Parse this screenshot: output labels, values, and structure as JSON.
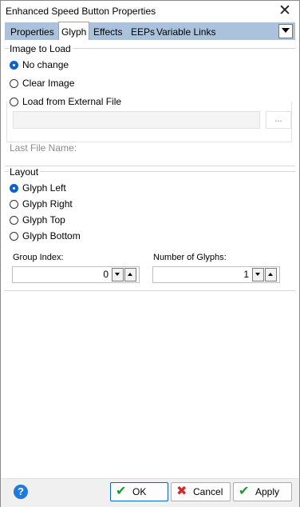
{
  "window": {
    "title": "Enhanced Speed Button Properties",
    "close_glyph": "✕"
  },
  "tabs": [
    {
      "label": "Properties",
      "active": false
    },
    {
      "label": "Glyph",
      "active": true
    },
    {
      "label": "Effects",
      "active": false
    },
    {
      "label": "EEPs",
      "active": false
    },
    {
      "label": "Variable Links",
      "active": false
    }
  ],
  "image_group": {
    "title": "Image to Load",
    "options": [
      {
        "label": "No change",
        "selected": true
      },
      {
        "label": "Clear Image",
        "selected": false
      },
      {
        "label": "Load from External File",
        "selected": false
      }
    ],
    "file_value": "",
    "browse_label": "...",
    "last_file_label": "Last File Name:"
  },
  "layout_group": {
    "title": "Layout",
    "options": [
      {
        "label": "Glyph Left",
        "selected": true
      },
      {
        "label": "Glyph Right",
        "selected": false
      },
      {
        "label": "Glyph Top",
        "selected": false
      },
      {
        "label": "Glyph Bottom",
        "selected": false
      }
    ],
    "group_index_label": "Group Index:",
    "group_index_value": "0",
    "num_glyphs_label": "Number of Glyphs:",
    "num_glyphs_value": "1"
  },
  "footer": {
    "help_glyph": "?",
    "ok_label": "OK",
    "cancel_label": "Cancel",
    "apply_label": "Apply"
  },
  "colors": {
    "accent": "#0b63ce",
    "tabbar": "#aac2dc",
    "ok_icon": "#1a9b2b",
    "cancel_icon": "#d6272b"
  }
}
